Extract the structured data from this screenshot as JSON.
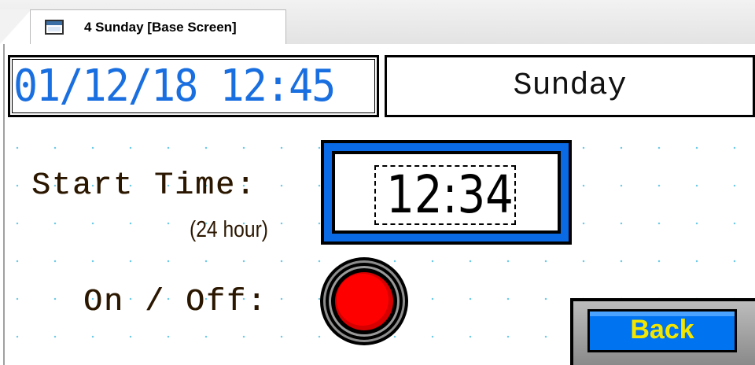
{
  "tab": {
    "label": "4 Sunday [Base Screen]",
    "icon": "screen-icon"
  },
  "screen": {
    "datetime": "01/12/18 12:45",
    "day": "Sunday",
    "start_time_label": "Start Time:",
    "hour_format_label": "(24 hour)",
    "start_time_value": "12:34",
    "onoff_label": "On / Off:",
    "lamp_state": "off",
    "lamp_color": "#ff0000",
    "back_label": "Back",
    "colors": {
      "datetime_text": "#1a6fe0",
      "time_frame": "#0a6ae6",
      "back_face": "#0073f0",
      "back_text": "#f2e600",
      "grid_dots": "#6ecbe8"
    }
  }
}
